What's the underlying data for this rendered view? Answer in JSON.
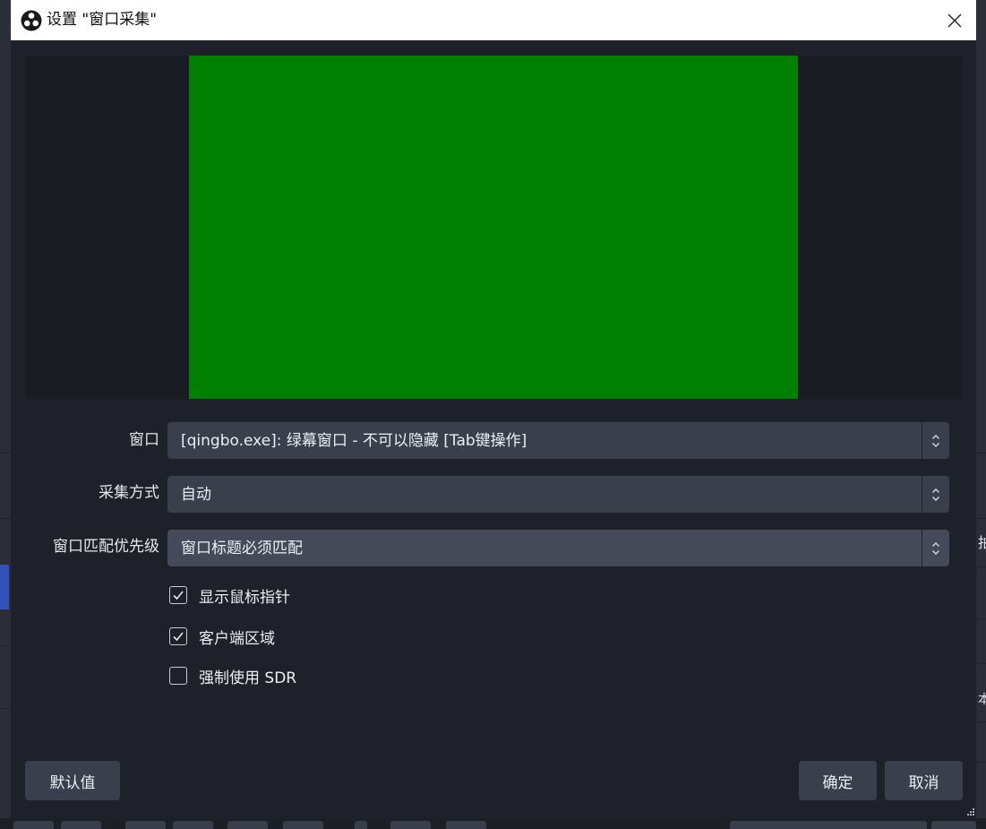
{
  "dialog": {
    "title": "设置 \"窗口采集\"",
    "app_icon": "obs-logo-icon",
    "close_icon": "close-icon"
  },
  "preview": {
    "capture_color": "#008000"
  },
  "fields": {
    "window": {
      "label": "窗口",
      "value": "[qingbo.exe]: 绿幕窗口 - 不可以隐藏 [Tab键操作]"
    },
    "capture_method": {
      "label": "采集方式",
      "value": "自动"
    },
    "match_priority": {
      "label": "窗口匹配优先级",
      "value": "窗口标题必须匹配"
    }
  },
  "checkboxes": [
    {
      "label": "显示鼠标指针",
      "checked": true
    },
    {
      "label": "客户端区域",
      "checked": true
    },
    {
      "label": "强制使用 SDR",
      "checked": false
    }
  ],
  "buttons": {
    "defaults": "默认值",
    "ok": "确定",
    "cancel": "取消"
  },
  "background": {
    "right_glyphs": [
      "拍",
      "本"
    ]
  },
  "colors": {
    "dialog_bg": "#1e212a",
    "field_bg": "#3b3f4c",
    "accent_blue": "#3252b8"
  }
}
